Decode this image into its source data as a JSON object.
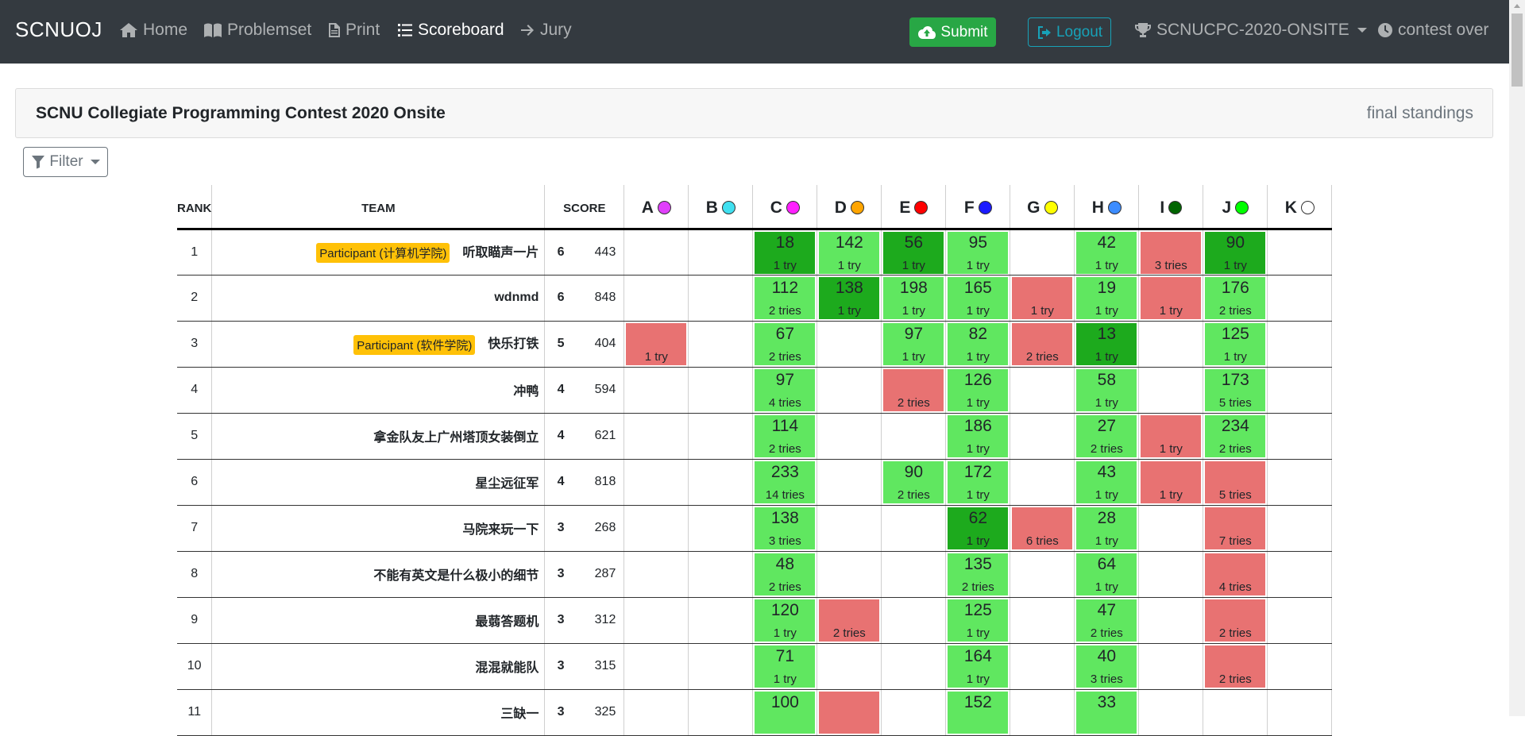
{
  "nav": {
    "brand": "SCNUOJ",
    "items": [
      {
        "key": "home",
        "label": "Home",
        "icon": "home-icon"
      },
      {
        "key": "problemset",
        "label": "Problemset",
        "icon": "book-icon"
      },
      {
        "key": "print",
        "label": "Print",
        "icon": "file-icon"
      },
      {
        "key": "scoreboard",
        "label": "Scoreboard",
        "icon": "list-icon",
        "active": true
      },
      {
        "key": "jury",
        "label": "Jury",
        "icon": "arrow-right-icon"
      }
    ],
    "submit_label": "Submit",
    "logout_label": "Logout",
    "contest_selector": "SCNUCPC-2020-ONSITE",
    "contest_status": "contest over"
  },
  "contest": {
    "title": "SCNU Collegiate Programming Contest 2020 Onsite",
    "standings_label": "final standings"
  },
  "filter_label": "Filter",
  "colors": {
    "accepted": "#60e760",
    "first_to_solve": "#1daa1d",
    "wrong": "#e87272",
    "navbar": "#343a40",
    "submit": "#28a745",
    "logout": "#17a2b8",
    "badge": "#ffc107"
  },
  "table": {
    "headers": {
      "rank": "RANK",
      "team": "TEAM",
      "score": "SCORE"
    },
    "problems": [
      {
        "letter": "A",
        "color": "#e040fb"
      },
      {
        "letter": "B",
        "color": "#40e0f0"
      },
      {
        "letter": "C",
        "color": "#ff20ff"
      },
      {
        "letter": "D",
        "color": "#ffa500"
      },
      {
        "letter": "E",
        "color": "#ff0000"
      },
      {
        "letter": "F",
        "color": "#1a1aff"
      },
      {
        "letter": "G",
        "color": "#ffff00"
      },
      {
        "letter": "H",
        "color": "#3c8cff"
      },
      {
        "letter": "I",
        "color": "#006400"
      },
      {
        "letter": "J",
        "color": "#00ff00"
      },
      {
        "letter": "K",
        "color": "#ffffff"
      }
    ],
    "rows": [
      {
        "rank": "1",
        "team": "听取瞄声一片",
        "badge": "Participant (计算机学院)",
        "solved": "6",
        "penalty": "443",
        "cells": [
          null,
          null,
          {
            "s": "first",
            "t": "18",
            "n": "1 try"
          },
          {
            "s": "ac",
            "t": "142",
            "n": "1 try"
          },
          {
            "s": "first",
            "t": "56",
            "n": "1 try"
          },
          {
            "s": "ac",
            "t": "95",
            "n": "1 try"
          },
          null,
          {
            "s": "ac",
            "t": "42",
            "n": "1 try"
          },
          {
            "s": "wa",
            "t": "",
            "n": "3 tries"
          },
          {
            "s": "first",
            "t": "90",
            "n": "1 try"
          },
          null
        ]
      },
      {
        "rank": "2",
        "team": "wdnmd",
        "badge": "",
        "solved": "6",
        "penalty": "848",
        "cells": [
          null,
          null,
          {
            "s": "ac",
            "t": "112",
            "n": "2 tries"
          },
          {
            "s": "first",
            "t": "138",
            "n": "1 try"
          },
          {
            "s": "ac",
            "t": "198",
            "n": "1 try"
          },
          {
            "s": "ac",
            "t": "165",
            "n": "1 try"
          },
          {
            "s": "wa",
            "t": "",
            "n": "1 try"
          },
          {
            "s": "ac",
            "t": "19",
            "n": "1 try"
          },
          {
            "s": "wa",
            "t": "",
            "n": "1 try"
          },
          {
            "s": "ac",
            "t": "176",
            "n": "2 tries"
          },
          null
        ]
      },
      {
        "rank": "3",
        "team": "快乐打铁",
        "badge": "Participant (软件学院)",
        "solved": "5",
        "penalty": "404",
        "cells": [
          {
            "s": "wa",
            "t": "",
            "n": "1 try"
          },
          null,
          {
            "s": "ac",
            "t": "67",
            "n": "2 tries"
          },
          null,
          {
            "s": "ac",
            "t": "97",
            "n": "1 try"
          },
          {
            "s": "ac",
            "t": "82",
            "n": "1 try"
          },
          {
            "s": "wa",
            "t": "",
            "n": "2 tries"
          },
          {
            "s": "first",
            "t": "13",
            "n": "1 try"
          },
          null,
          {
            "s": "ac",
            "t": "125",
            "n": "1 try"
          },
          null
        ]
      },
      {
        "rank": "4",
        "team": "冲鸭",
        "badge": "",
        "solved": "4",
        "penalty": "594",
        "cells": [
          null,
          null,
          {
            "s": "ac",
            "t": "97",
            "n": "4 tries"
          },
          null,
          {
            "s": "wa",
            "t": "",
            "n": "2 tries"
          },
          {
            "s": "ac",
            "t": "126",
            "n": "1 try"
          },
          null,
          {
            "s": "ac",
            "t": "58",
            "n": "1 try"
          },
          null,
          {
            "s": "ac",
            "t": "173",
            "n": "5 tries"
          },
          null
        ]
      },
      {
        "rank": "5",
        "team": "拿金队友上广州塔顶女装倒立",
        "badge": "",
        "solved": "4",
        "penalty": "621",
        "cells": [
          null,
          null,
          {
            "s": "ac",
            "t": "114",
            "n": "2 tries"
          },
          null,
          null,
          {
            "s": "ac",
            "t": "186",
            "n": "1 try"
          },
          null,
          {
            "s": "ac",
            "t": "27",
            "n": "2 tries"
          },
          {
            "s": "wa",
            "t": "",
            "n": "1 try"
          },
          {
            "s": "ac",
            "t": "234",
            "n": "2 tries"
          },
          null
        ]
      },
      {
        "rank": "6",
        "team": "星尘远征军",
        "badge": "",
        "solved": "4",
        "penalty": "818",
        "cells": [
          null,
          null,
          {
            "s": "ac",
            "t": "233",
            "n": "14 tries"
          },
          null,
          {
            "s": "ac",
            "t": "90",
            "n": "2 tries"
          },
          {
            "s": "ac",
            "t": "172",
            "n": "1 try"
          },
          null,
          {
            "s": "ac",
            "t": "43",
            "n": "1 try"
          },
          {
            "s": "wa",
            "t": "",
            "n": "1 try"
          },
          {
            "s": "wa",
            "t": "",
            "n": "5 tries"
          },
          null
        ]
      },
      {
        "rank": "7",
        "team": "马院来玩一下",
        "badge": "",
        "solved": "3",
        "penalty": "268",
        "cells": [
          null,
          null,
          {
            "s": "ac",
            "t": "138",
            "n": "3 tries"
          },
          null,
          null,
          {
            "s": "first",
            "t": "62",
            "n": "1 try"
          },
          {
            "s": "wa",
            "t": "",
            "n": "6 tries"
          },
          {
            "s": "ac",
            "t": "28",
            "n": "1 try"
          },
          null,
          {
            "s": "wa",
            "t": "",
            "n": "7 tries"
          },
          null
        ]
      },
      {
        "rank": "8",
        "team": "不能有英文是什么极小的细节",
        "badge": "",
        "solved": "3",
        "penalty": "287",
        "cells": [
          null,
          null,
          {
            "s": "ac",
            "t": "48",
            "n": "2 tries"
          },
          null,
          null,
          {
            "s": "ac",
            "t": "135",
            "n": "2 tries"
          },
          null,
          {
            "s": "ac",
            "t": "64",
            "n": "1 try"
          },
          null,
          {
            "s": "wa",
            "t": "",
            "n": "4 tries"
          },
          null
        ]
      },
      {
        "rank": "9",
        "team": "最蒻答题机",
        "badge": "",
        "solved": "3",
        "penalty": "312",
        "cells": [
          null,
          null,
          {
            "s": "ac",
            "t": "120",
            "n": "1 try"
          },
          {
            "s": "wa",
            "t": "",
            "n": "2 tries"
          },
          null,
          {
            "s": "ac",
            "t": "125",
            "n": "1 try"
          },
          null,
          {
            "s": "ac",
            "t": "47",
            "n": "2 tries"
          },
          null,
          {
            "s": "wa",
            "t": "",
            "n": "2 tries"
          },
          null
        ]
      },
      {
        "rank": "10",
        "team": "混混就能队",
        "badge": "",
        "solved": "3",
        "penalty": "315",
        "cells": [
          null,
          null,
          {
            "s": "ac",
            "t": "71",
            "n": "1 try"
          },
          null,
          null,
          {
            "s": "ac",
            "t": "164",
            "n": "1 try"
          },
          null,
          {
            "s": "ac",
            "t": "40",
            "n": "3 tries"
          },
          null,
          {
            "s": "wa",
            "t": "",
            "n": "2 tries"
          },
          null
        ]
      },
      {
        "rank": "11",
        "team": "三缺一",
        "badge": "",
        "solved": "3",
        "penalty": "325",
        "cells": [
          null,
          null,
          {
            "s": "ac",
            "t": "100",
            "n": ""
          },
          {
            "s": "wa",
            "t": "",
            "n": ""
          },
          null,
          {
            "s": "ac",
            "t": "152",
            "n": ""
          },
          null,
          {
            "s": "ac",
            "t": "33",
            "n": ""
          },
          null,
          null,
          null
        ]
      }
    ]
  }
}
